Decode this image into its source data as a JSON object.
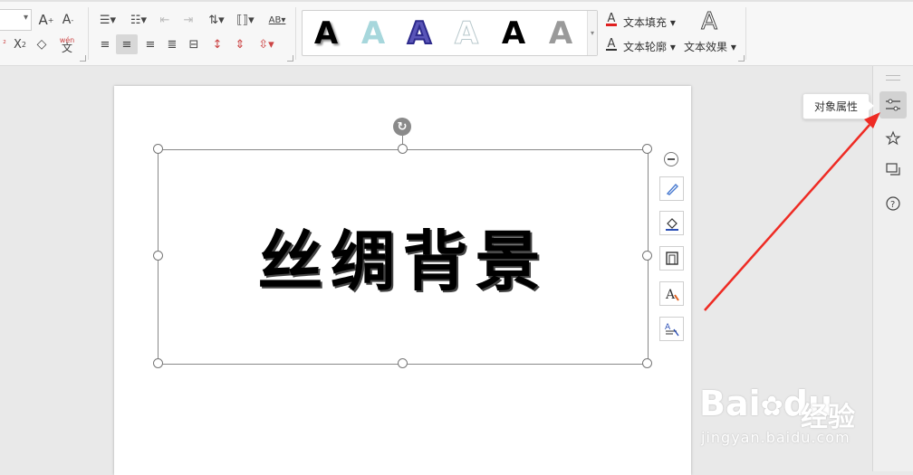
{
  "ribbon": {
    "font_size_value": "",
    "grow_font_label": "A⁺",
    "shrink_font_label": "A⁻",
    "ab_label": "AB",
    "wen_label": "wén",
    "wen_char": "文",
    "text_fill_label": "文本填充",
    "text_outline_label": "文本轮廓",
    "text_effect_label": "文本效果",
    "style_gallery": [
      {
        "glyph": "A",
        "style": "black-shadow"
      },
      {
        "glyph": "A",
        "style": "light-blue"
      },
      {
        "glyph": "A",
        "style": "blue-outline"
      },
      {
        "glyph": "A",
        "style": "white-outline"
      },
      {
        "glyph": "A",
        "style": "plain-black"
      },
      {
        "glyph": "A",
        "style": "gray-gradient"
      }
    ]
  },
  "tooltip": {
    "text": "对象属性"
  },
  "canvas": {
    "art_text": "丝绸背景"
  },
  "watermark": {
    "brand": "Bai",
    "brand2": "du",
    "cn": "经验",
    "url": "jingyan.baidu.com"
  },
  "colors": {
    "accent_arrow": "#ee2b24",
    "fill_red": "#e02020",
    "ribbon_bg": "#f7f7f7",
    "canvas_bg": "#e9e9e9"
  }
}
